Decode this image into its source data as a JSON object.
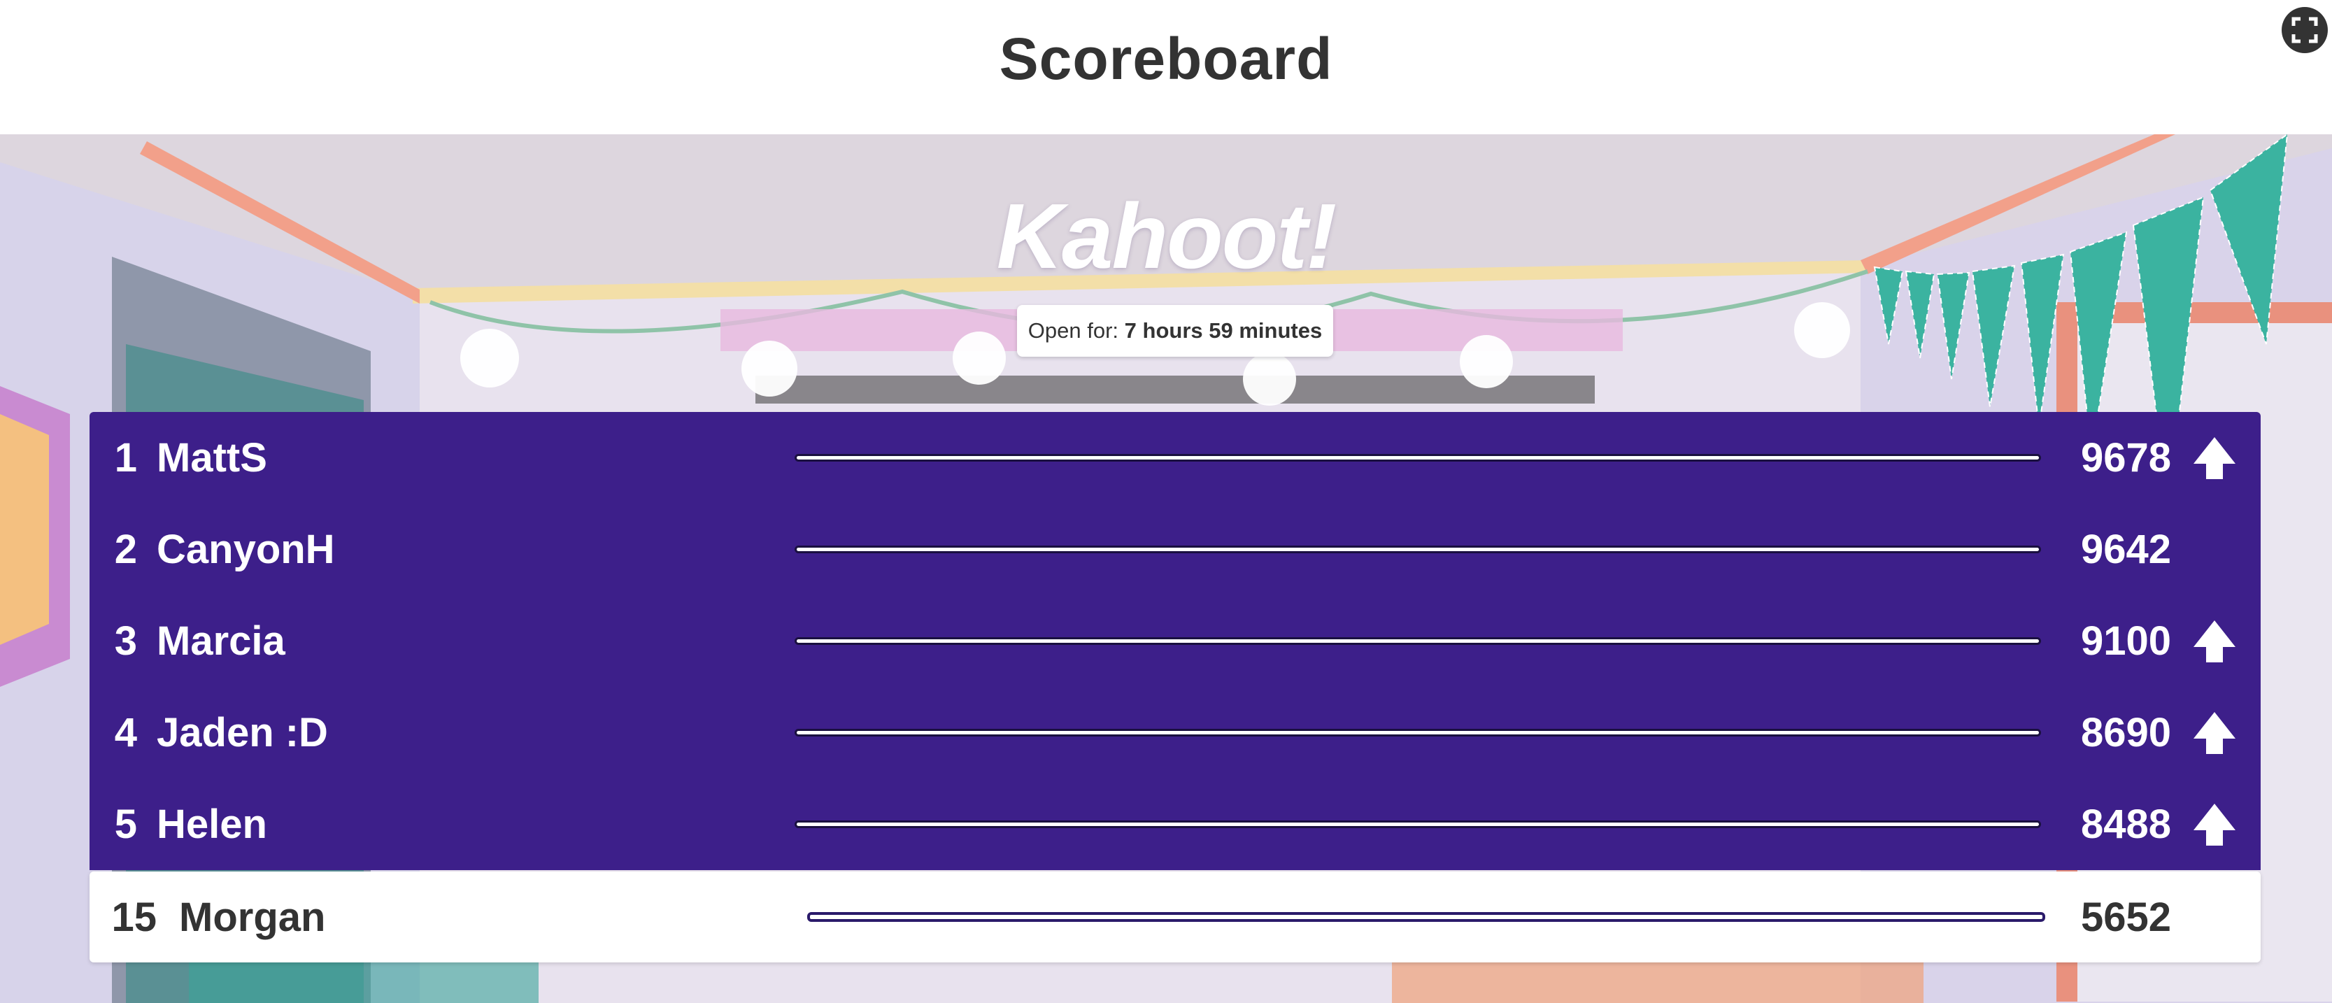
{
  "header": {
    "title": "Scoreboard"
  },
  "toolbar": {
    "fullscreen_icon": "fullscreen-icon"
  },
  "logo": {
    "text": "Kahoot!"
  },
  "status": {
    "open_label": "Open for:",
    "open_value": "7 hours 59 minutes"
  },
  "leaderboard": [
    {
      "rank": "1",
      "name": "MattS",
      "score": "9678",
      "trend": "up"
    },
    {
      "rank": "2",
      "name": "CanyonH",
      "score": "9642",
      "trend": "none"
    },
    {
      "rank": "3",
      "name": "Marcia",
      "score": "9100",
      "trend": "up"
    },
    {
      "rank": "4",
      "name": "Jaden :D",
      "score": "8690",
      "trend": "up"
    },
    {
      "rank": "5",
      "name": "Helen",
      "score": "8488",
      "trend": "up"
    }
  ],
  "current_player": {
    "rank": "15",
    "name": "Morgan",
    "score": "5652"
  },
  "colors": {
    "row_background": "#3d1f8a",
    "highlight_row": "#ffffff",
    "title_text": "#333333",
    "bunting": "#3bb3a0"
  }
}
